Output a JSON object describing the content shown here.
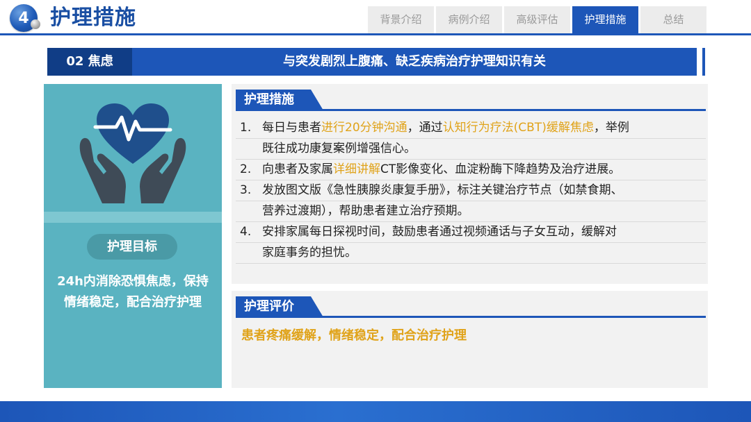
{
  "header": {
    "section_number": "4",
    "title": "护理措施",
    "tabs": [
      {
        "label": "背景介绍",
        "active": false
      },
      {
        "label": "病例介绍",
        "active": false
      },
      {
        "label": "高级评估",
        "active": false
      },
      {
        "label": "护理措施",
        "active": true
      },
      {
        "label": "总结",
        "active": false
      }
    ]
  },
  "topic": {
    "label": "02 焦虑",
    "text": "与突发剧烈上腹痛、缺乏疾病治疗护理知识有关"
  },
  "left_panel": {
    "icon": "heart-in-hands-icon",
    "goal_label": "护理目标",
    "goal_text": "24h内消除恐惧焦虑，保持情绪稳定，配合治疗护理"
  },
  "measures": {
    "heading": "护理措施",
    "items": [
      {
        "num": "1.",
        "line1": {
          "a": "每日与患者",
          "h1": "进行20分钟沟通",
          "b": "，通过",
          "h2": "认知行为疗法(CBT)缓解焦虑",
          "c": "，举例"
        },
        "line2": "既往成功康复案例增强信心。"
      },
      {
        "num": "2.",
        "line1": {
          "a": "向患者及家属",
          "h1": "详细讲解",
          "b": "CT影像变化、血淀粉酶下降趋势及治疗进展。"
        }
      },
      {
        "num": "3.",
        "line1": "发放图文版《急性胰腺炎康复手册》，标注关键治疗节点（如禁食期、",
        "line2": "营养过渡期），帮助患者建立治疗预期。"
      },
      {
        "num": "4.",
        "line1": "安排家属每日探视时间，鼓励患者通过视频通话与子女互动，缓解对",
        "line2": "家庭事务的担忧。"
      }
    ]
  },
  "evaluation": {
    "heading": "护理评价",
    "text": "患者疼痛缓解，情绪稳定，配合治疗护理"
  },
  "colors": {
    "primary_blue": "#1d56b8",
    "dark_blue": "#103d86",
    "teal": "#5ab3c1",
    "highlight": "#e0a31a"
  }
}
